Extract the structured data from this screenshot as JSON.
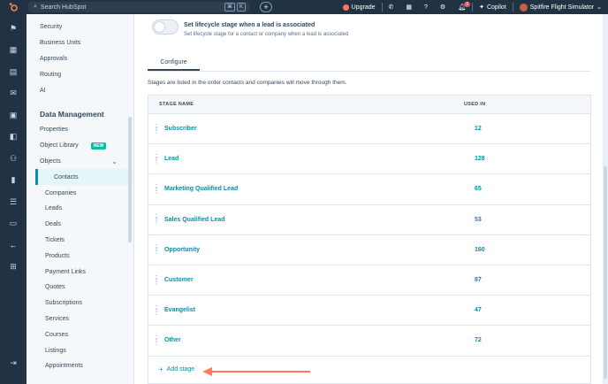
{
  "topbar": {
    "search_placeholder": "Search HubSpot",
    "kbd": [
      "⌘",
      "K"
    ],
    "upgrade_label": "Upgrade",
    "notification_count": "2",
    "copilot_label": "Copilot",
    "account_name": "Spitfire Flight Simulator"
  },
  "nav": {
    "top_items": [
      "Security",
      "Business Units",
      "Approvals",
      "Routing",
      "AI"
    ],
    "section_title": "Data Management",
    "properties": "Properties",
    "object_library": "Object Library",
    "new_badge": "NEW",
    "objects": "Objects",
    "object_items": [
      "Contacts",
      "Companies",
      "Leads",
      "Deals",
      "Tickets",
      "Products",
      "Payment Links",
      "Quotes",
      "Subscriptions",
      "Services",
      "Courses",
      "Listings",
      "Appointments"
    ],
    "active_item": "Contacts"
  },
  "setting": {
    "title": "Set lifecycle stage when a lead is associated",
    "description": "Set lifecycle stage for a contact or company when a lead is associated",
    "enabled": false
  },
  "tabs": {
    "configure": "Configure"
  },
  "info_text": "Stages are listed in the order contacts and companies will move through them.",
  "table": {
    "col_stage": "STAGE NAME",
    "col_used": "USED IN",
    "rows": [
      {
        "name": "Subscriber",
        "used": "12"
      },
      {
        "name": "Lead",
        "used": "128"
      },
      {
        "name": "Marketing Qualified Lead",
        "used": "65"
      },
      {
        "name": "Sales Qualified Lead",
        "used": "53"
      },
      {
        "name": "Opportunity",
        "used": "160"
      },
      {
        "name": "Customer",
        "used": "87"
      },
      {
        "name": "Evangelist",
        "used": "47"
      },
      {
        "name": "Other",
        "used": "72"
      }
    ],
    "add_stage": "Add stage"
  },
  "colors": {
    "accent": "#0091ae",
    "arrow": "#ff7a59",
    "nav_bg": "#213343"
  }
}
